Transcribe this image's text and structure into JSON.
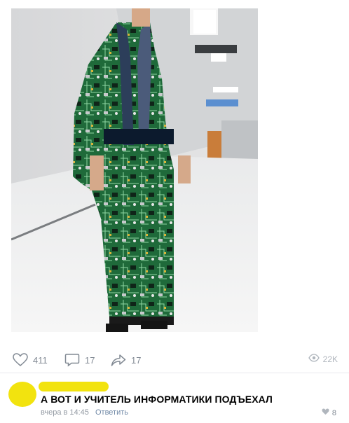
{
  "post": {
    "photo": "photo-man-in-circuit-board-kimono"
  },
  "actions": {
    "like_count": "411",
    "comment_count": "17",
    "share_count": "17",
    "views_count": "22K"
  },
  "comment": {
    "text": "А ВОТ И УЧИТЕЛЬ ИНФОРМАТИКИ ПОДЪЕХАЛ",
    "time": "вчера в 14:45",
    "reply_label": "Ответить",
    "like_count": "8"
  },
  "colors": {
    "redaction_yellow": "#f2e30f",
    "kimono_green": "#1f6a3a",
    "icon_gray": "#828a94"
  }
}
